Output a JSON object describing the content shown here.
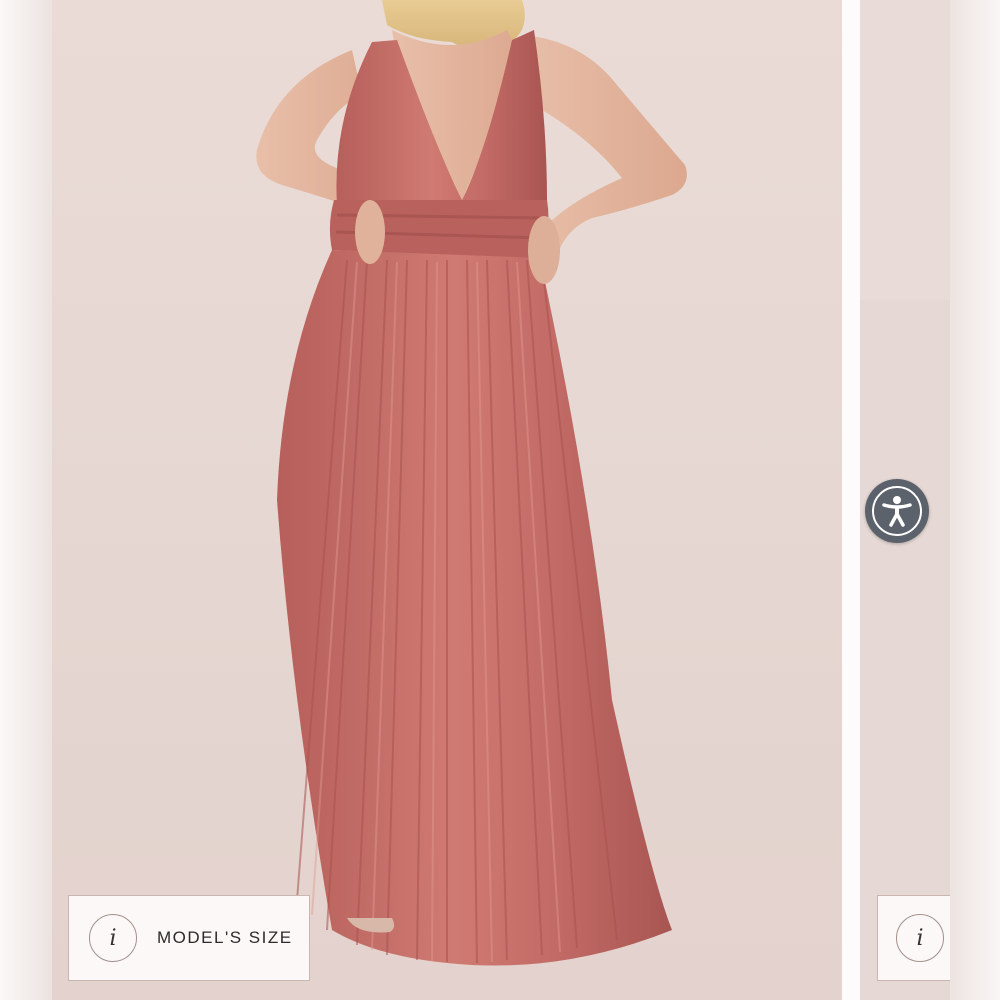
{
  "gallery": {
    "main_image": {
      "alt": "",
      "dress_color": "#c8716b"
    },
    "model_size_button": {
      "label": "MODEL'S SIZE",
      "icon": "info-icon",
      "glyph": "i"
    },
    "next_model_size_button": {
      "icon": "info-icon",
      "glyph": "i"
    }
  },
  "accessibility_button": {
    "icon": "accessibility-icon",
    "color": "#5c626b"
  }
}
